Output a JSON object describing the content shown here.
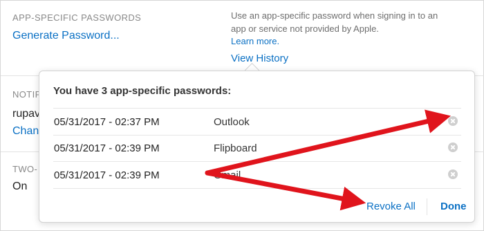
{
  "app_specific": {
    "section_label": "APP-SPECIFIC PASSWORDS",
    "generate_link": "Generate Password...",
    "description": "Use an app-specific password when signing in to an app or service not provided by Apple.",
    "learn_more": "Learn more.",
    "view_history": "View History"
  },
  "background": {
    "notif_label_partial": "NOTIF",
    "email_partial": "rupav",
    "change_partial": "Chan",
    "two_label_partial": "TWO-",
    "two_value": "On"
  },
  "popover": {
    "title": "You have 3 app-specific passwords:",
    "passwords": [
      {
        "date": "05/31/2017 - 02:37 PM",
        "app": "Outlook"
      },
      {
        "date": "05/31/2017 - 02:39 PM",
        "app": "Flipboard"
      },
      {
        "date": "05/31/2017 - 02:39 PM",
        "app": "Gmail"
      }
    ],
    "revoke_all": "Revoke All",
    "done": "Done"
  },
  "colors": {
    "link": "#0a70c4",
    "annotation_arrow": "#e0141c"
  },
  "icons": {
    "revoke": "close-circle-icon",
    "annotation": "red-arrow"
  }
}
